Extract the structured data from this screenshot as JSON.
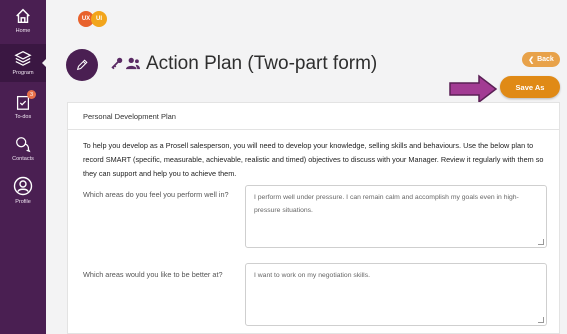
{
  "sidebar": {
    "items": [
      {
        "label": "Home",
        "icon": "home-icon"
      },
      {
        "label": "Program",
        "icon": "layers-icon"
      },
      {
        "label": "To-dos",
        "icon": "clipboard-icon",
        "badge": "3"
      },
      {
        "label": "Contacts",
        "icon": "chat-icon"
      },
      {
        "label": "Profile",
        "icon": "user-icon"
      }
    ]
  },
  "logo": {
    "left": "UX",
    "right": "UI"
  },
  "header": {
    "title": "Action Plan (Two-part form)"
  },
  "buttons": {
    "back": "Back",
    "save_as": "Save As"
  },
  "form": {
    "section_title": "Personal Development Plan",
    "intro": "To help you develop as a Prosell salesperson, you will need to develop your knowledge, selling skills and behaviours. Use the below plan to record SMART (specific, measurable, achievable, realistic and timed) objectives to discuss with your Manager. Review it regularly with them so they can support and help you to achieve them.",
    "questions": [
      {
        "label": "Which areas do you feel you perform well in?",
        "answer": "I perform well under pressure. I can remain calm and accomplish my goals even in high-pressure situations."
      },
      {
        "label": "Which areas would you like to be better at?",
        "answer": "I want to work on my negotiation skills."
      }
    ]
  },
  "colors": {
    "sidebar": "#4a1f52",
    "accent": "#e08a16",
    "arrow": "#9b3a8f"
  }
}
